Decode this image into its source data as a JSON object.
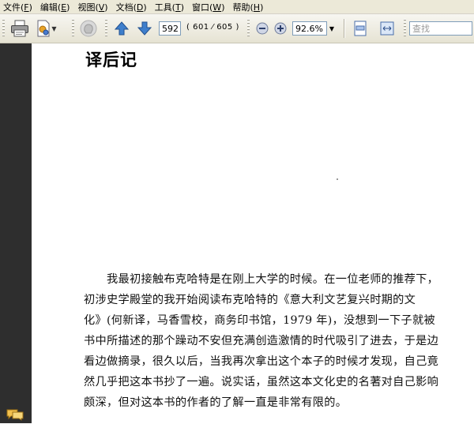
{
  "menu": [
    {
      "label": "文件",
      "key": "F"
    },
    {
      "label": "编辑",
      "key": "E"
    },
    {
      "label": "视图",
      "key": "V"
    },
    {
      "label": "文档",
      "key": "D"
    },
    {
      "label": "工具",
      "key": "T"
    },
    {
      "label": "窗口",
      "key": "W"
    },
    {
      "label": "帮助",
      "key": "H"
    }
  ],
  "toolbar": {
    "page_number": "592",
    "page_count": "( 601 ⁄ 605 )",
    "zoom": "92.6%",
    "search_placeholder": "查找",
    "icons": [
      "print-icon",
      "share-icon",
      "hand-tool-icon",
      "previous-page-icon",
      "next-page-icon",
      "zoom-out-icon",
      "zoom-in-icon",
      "fit-page-icon",
      "fit-width-icon"
    ]
  },
  "document": {
    "heading": "译后记",
    "lines": [
      "　　我最初接触布克哈特是在刚上大学的时候。在一位老师的推荐下，",
      "初涉史学殿堂的我开始阅读布克哈特的《意大利文艺复兴时期的文",
      "化》(何新译，马香雪校，商务印书馆，1979 年)，没想到一下子就被",
      "书中所描述的那个躁动不安但充满创造激情的时代吸引了进去，于是边",
      "看边做摘录，很久以后，当我再次拿出这个本子的时候才发现，自己竟",
      "然几乎把这本书抄了一遍。说实话，虽然这本文化史的名著对自己影响",
      "颇深，但对这本书的作者的了解一直是非常有限的。"
    ]
  }
}
